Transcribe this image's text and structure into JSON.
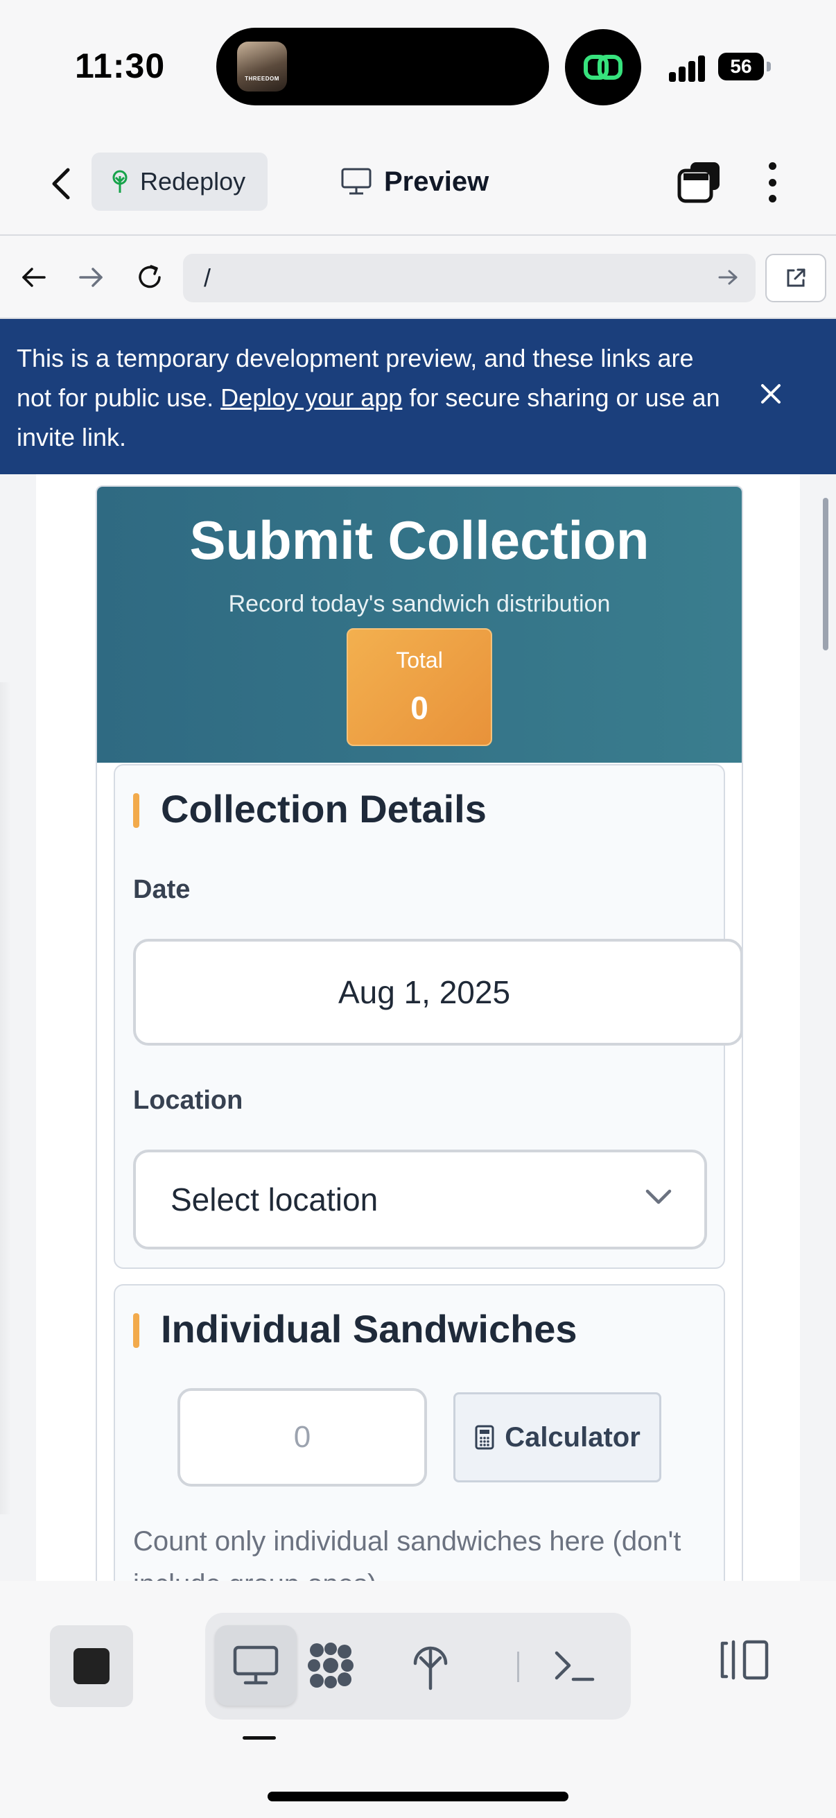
{
  "status_bar": {
    "time": "11:30",
    "battery": "56",
    "now_playing_art_text": "THREEDOM"
  },
  "header": {
    "redeploy_label": "Redeploy",
    "preview_label": "Preview"
  },
  "browser": {
    "url": "/"
  },
  "banner": {
    "text_before_link": "This is a temporary development preview, and these links are not for public use. ",
    "link_text": "Deploy your app",
    "text_after_link": " for secure sharing or use an invite link."
  },
  "hero": {
    "title": "Submit Collection",
    "subtitle": "Record today's sandwich distribution",
    "total_label": "Total",
    "total_value": "0"
  },
  "collection_details": {
    "title": "Collection Details",
    "date_label": "Date",
    "date_value": "Aug 1, 2025",
    "location_label": "Location",
    "location_placeholder": "Select location"
  },
  "individual_sandwiches": {
    "title": "Individual Sandwiches",
    "count_placeholder": "0",
    "calculator_label": "Calculator",
    "hint": "Count only individual sandwiches here (don't include group ones)."
  },
  "colors": {
    "banner_bg": "#1b3f7c",
    "hero_bg": "#2f6a82",
    "accent_orange": "#f2aa4c",
    "total_box": "#e8923a"
  },
  "icons": {
    "back": "chevron-left-icon",
    "redeploy": "tree-icon",
    "preview": "monitor-icon",
    "tabs": "tabs-icon",
    "more": "kebab-icon",
    "nav_back": "arrow-left-icon",
    "nav_forward": "arrow-right-icon",
    "reload": "reload-icon",
    "go": "arrow-right-icon",
    "open_external": "external-link-icon",
    "close": "close-icon",
    "select": "chevron-down-icon",
    "calculator": "calculator-icon",
    "stop": "stop-icon",
    "toolbar_preview": "monitor-icon",
    "toolbar_apps": "blob-grid-icon",
    "toolbar_deploy": "deploy-tree-icon",
    "toolbar_shell": "terminal-icon",
    "panel_toggle": "panel-toggle-icon"
  }
}
